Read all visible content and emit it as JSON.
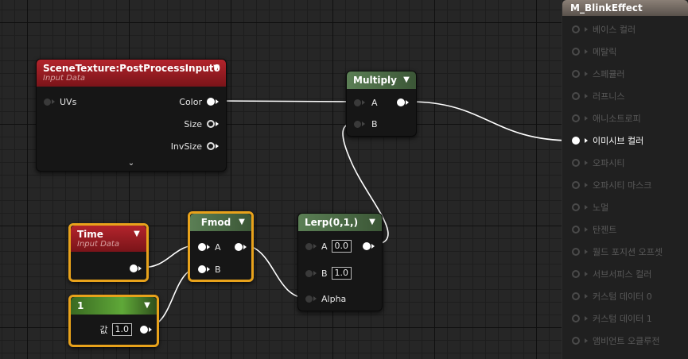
{
  "nodes": {
    "scene_texture": {
      "title": "SceneTexture:PostProcessInput0",
      "subtitle": "Input Data",
      "inputs": [
        {
          "label": "UVs"
        }
      ],
      "outputs": [
        {
          "label": "Color"
        },
        {
          "label": "Size"
        },
        {
          "label": "InvSize"
        }
      ],
      "expand_icon": "chevron-down-icon"
    },
    "multiply": {
      "title": "Multiply",
      "inputs": [
        {
          "label": "A"
        },
        {
          "label": "B"
        }
      ]
    },
    "time": {
      "title": "Time",
      "subtitle": "Input Data"
    },
    "fmod": {
      "title": "Fmod",
      "inputs": [
        {
          "label": "A"
        },
        {
          "label": "B"
        }
      ]
    },
    "lerp": {
      "title": "Lerp(0,1,)",
      "inputs": [
        {
          "label": "A",
          "value": "0.0"
        },
        {
          "label": "B",
          "value": "1.0"
        },
        {
          "label": "Alpha"
        }
      ]
    },
    "constant": {
      "title": "1",
      "value_label": "값",
      "value": "1.0"
    }
  },
  "material_panel": {
    "title": "M_BlinkEffect",
    "pins": [
      {
        "label": "베이스 컬러",
        "active": false
      },
      {
        "label": "메탈릭",
        "active": false
      },
      {
        "label": "스페큘러",
        "active": false
      },
      {
        "label": "러프니스",
        "active": false
      },
      {
        "label": "애니소트로피",
        "active": false
      },
      {
        "label": "이미시브 컬러",
        "active": true
      },
      {
        "label": "오파시티",
        "active": false
      },
      {
        "label": "오파시티 마스크",
        "active": false
      },
      {
        "label": "노멀",
        "active": false
      },
      {
        "label": "탄젠트",
        "active": false
      },
      {
        "label": "월드 포지션 오프셋",
        "active": false
      },
      {
        "label": "서브서피스 컬러",
        "active": false
      },
      {
        "label": "커스텀 데이터 0",
        "active": false
      },
      {
        "label": "커스텀 데이터 1",
        "active": false
      },
      {
        "label": "앰비언트 오클루전",
        "active": false
      }
    ]
  },
  "colors": {
    "selection": "#e8a21b",
    "wire": "#ffffff",
    "scene_texture_header": "#b3242c",
    "math_header": "#5b7f55",
    "constant_header": "#5fa838"
  }
}
